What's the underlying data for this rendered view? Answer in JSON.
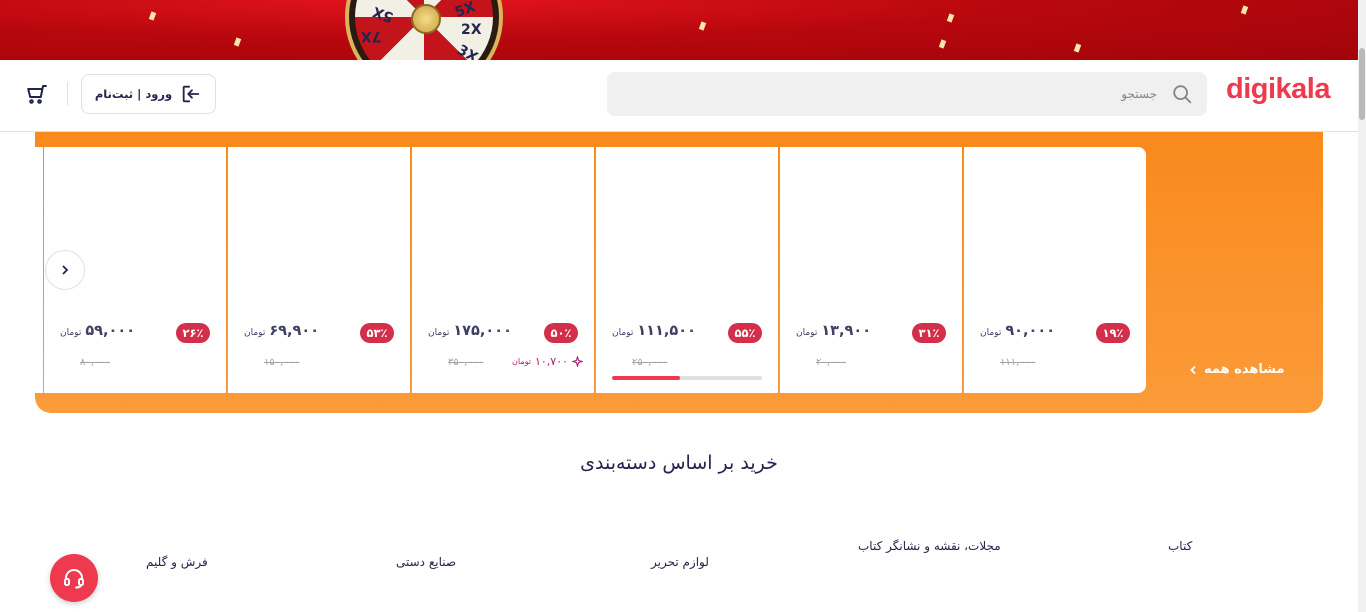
{
  "promo_banner": {
    "wheel_labels": [
      "5X",
      "2X",
      "3X",
      "7X",
      "5X"
    ]
  },
  "header": {
    "logo": "digikala",
    "search": {
      "placeholder": "جستجو",
      "value": ""
    },
    "login_label": "ورود | ثبت‌نام"
  },
  "amazing_offers": {
    "view_all_label": "مشاهده همه",
    "cards": [
      {
        "discount": "۱۹٪",
        "price": "۹۰,۰۰۰",
        "currency": "تومان",
        "old_price": "۱۱۱,۰۰۰"
      },
      {
        "discount": "۳۱٪",
        "price": "۱۳,۹۰۰",
        "currency": "تومان",
        "old_price": "۲۰,۰۰۰"
      },
      {
        "discount": "۵۵٪",
        "price": "۱۱۱,۵۰۰",
        "currency": "تومان",
        "old_price": "۲۵۰,۰۰۰",
        "stock_sold_fraction": 0.45
      },
      {
        "discount": "۵۰٪",
        "price": "۱۷۵,۰۰۰",
        "currency": "تومان",
        "old_price": "۳۵۰,۰۰۰",
        "club_price": "۱۰,۷۰۰",
        "club_currency": "تومان"
      },
      {
        "discount": "۵۳٪",
        "price": "۶۹,۹۰۰",
        "currency": "تومان",
        "old_price": "۱۵۰,۰۰۰"
      },
      {
        "discount": "۲۶٪",
        "price": "۵۹,۰۰۰",
        "currency": "تومان",
        "old_price": "۸۰,۰۰۰"
      }
    ]
  },
  "categories": {
    "title": "خرید بر اساس دسته‌بندی",
    "items": [
      "کتاب",
      "مجلات، نقشه و نشانگر کتاب",
      "لوازم تحریر",
      "صنایع دستی",
      "فرش و گلیم"
    ]
  },
  "colors": {
    "brand": "#ef394e",
    "offer_band": "#f98a1c",
    "discount_badge": "#d32f4a",
    "club_price": "#a4236e"
  }
}
